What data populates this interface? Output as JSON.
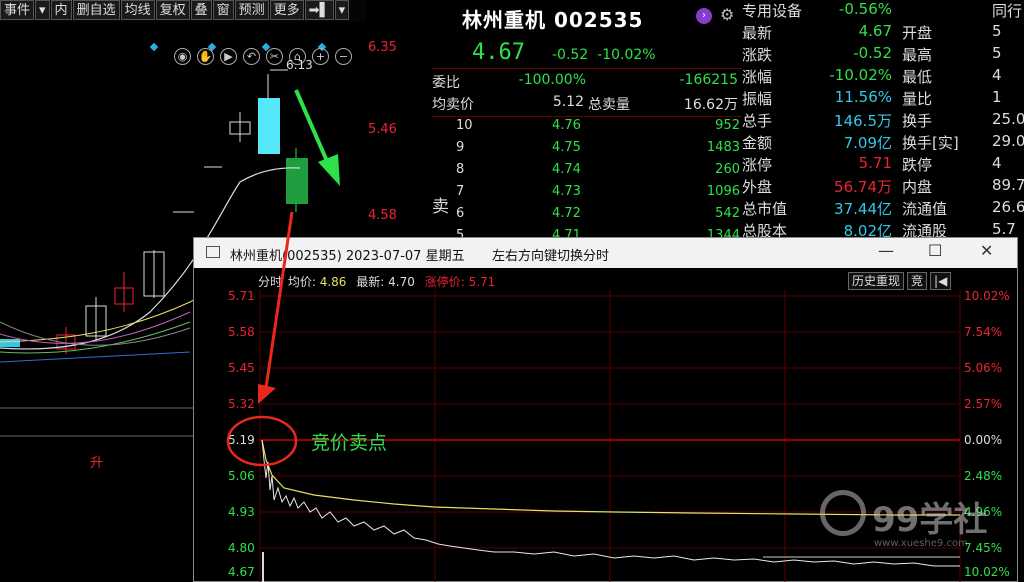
{
  "toolbar": {
    "items": [
      "事件",
      "▾",
      "内",
      "删自选",
      "均线",
      "复权",
      "叠",
      "窗",
      "预测",
      "更多",
      "➡▌",
      "▾"
    ]
  },
  "kchart": {
    "high_label": "6.13",
    "price_axis": [
      "6.35",
      "5.46",
      "4.58"
    ],
    "bottom_label": "升"
  },
  "quote": {
    "name": "林州重机 002535",
    "price": "4.67",
    "change": "-0.52",
    "change_pct": "-10.02%",
    "weibi_label": "委比",
    "weibi_pct": "-100.00%",
    "weibi_val": "-166215",
    "avg_label": "均卖价",
    "avg_val": "5.12",
    "total_label": "总卖量",
    "total_val": "16.62万",
    "side_label": "卖",
    "sell": [
      {
        "level": "10",
        "price": "4.76",
        "qty": "952"
      },
      {
        "level": "9",
        "price": "4.75",
        "qty": "1483"
      },
      {
        "level": "8",
        "price": "4.74",
        "qty": "260"
      },
      {
        "level": "7",
        "price": "4.73",
        "qty": "1096"
      },
      {
        "level": "6",
        "price": "4.72",
        "qty": "542"
      },
      {
        "level": "5",
        "price": "4.71",
        "qty": "1344"
      }
    ]
  },
  "info": {
    "sector": "专用设备",
    "sector_pct": "-0.56%",
    "peer_label": "同行",
    "rows": [
      {
        "a": "最新",
        "b": "4.67",
        "bc": "#2ee04a",
        "c": "开盘",
        "d": "5"
      },
      {
        "a": "涨跌",
        "b": "-0.52",
        "bc": "#2ee04a",
        "c": "最高",
        "d": "5"
      },
      {
        "a": "涨幅",
        "b": "-10.02%",
        "bc": "#2ee04a",
        "c": "最低",
        "d": "4"
      },
      {
        "a": "振幅",
        "b": "11.56%",
        "bc": "#33c8e8",
        "c": "量比",
        "d": "1"
      },
      {
        "a": "总手",
        "b": "146.5万",
        "bc": "#33c8e8",
        "c": "换手",
        "d": "25.0"
      },
      {
        "a": "金额",
        "b": "7.09亿",
        "bc": "#33c8e8",
        "c": "换手[实]",
        "d": "29.0"
      },
      {
        "a": "涨停",
        "b": "5.71",
        "bc": "#e23",
        "c": "跌停",
        "d": "4"
      },
      {
        "a": "外盘",
        "b": "56.74万",
        "bc": "#e23",
        "c": "内盘",
        "d": "89.7"
      },
      {
        "a": "总市值",
        "b": "37.44亿",
        "bc": "#33c8e8",
        "c": "流通值",
        "d": "26.6"
      },
      {
        "a": "总股本",
        "b": "8.02亿",
        "bc": "#33c8e8",
        "c": "流通股",
        "d": "5.7"
      }
    ]
  },
  "popup": {
    "title": "林州重机(002535) 2023-07-07 星期五",
    "hint": "左右方向键切换分时",
    "fenshi": "分时",
    "avg_label": "均价:",
    "avg_val": "4.86",
    "latest_label": "最新:",
    "latest_val": "4.70",
    "limit_label": "涨停价:",
    "limit_val": "5.71",
    "btn_history": "历史重现",
    "btn_jing": "竞",
    "btn_back": "|◀",
    "left_axis": [
      "5.71",
      "5.58",
      "5.45",
      "5.32",
      "5.19",
      "5.06",
      "4.93",
      "4.80",
      "4.67"
    ],
    "right_axis": [
      "10.02%",
      "7.54%",
      "5.06%",
      "2.57%",
      "0.00%",
      "2.48%",
      "4.96%",
      "7.45%",
      "10.02%"
    ]
  },
  "annotation": "竞价卖点",
  "watermark": {
    "text": "99学社",
    "url": "www.xueshe9.com"
  },
  "colors": {
    "up": "#e23",
    "down": "#2ee04a",
    "cyan": "#33c8e8",
    "annot": "#e8281c"
  }
}
